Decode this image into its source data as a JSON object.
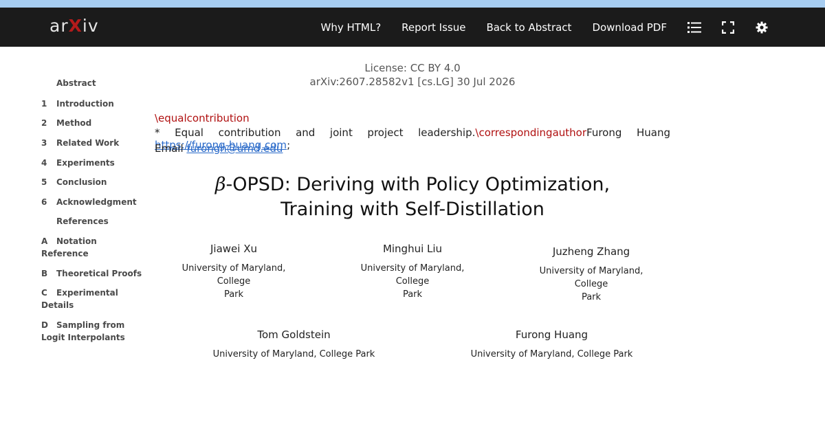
{
  "navbar": {
    "logo_pre": "ar",
    "logo_x": "X",
    "logo_post": "iv",
    "links": [
      "Why HTML?",
      "Report Issue",
      "Back to Abstract",
      "Download PDF"
    ],
    "icons": [
      "list-icon",
      "fullscreen-icon",
      "gear-icon"
    ]
  },
  "toc": [
    {
      "num": "",
      "text": "Abstract"
    },
    {
      "num": "1",
      "text": "Introduction"
    },
    {
      "num": "2",
      "text": "Method"
    },
    {
      "num": "3",
      "text": "Related Work"
    },
    {
      "num": "4",
      "text": "Experiments"
    },
    {
      "num": "5",
      "text": "Conclusion"
    },
    {
      "num": "6",
      "text": "Acknowledgment"
    },
    {
      "num": "",
      "text": "References"
    },
    {
      "num": "A",
      "text": "Notation",
      "text2": "Reference"
    },
    {
      "num": "B",
      "text": "Theoretical Proofs"
    },
    {
      "num": "C",
      "text": "Experimental",
      "text2": "Details"
    },
    {
      "num": "D",
      "text": "Sampling from",
      "text2": "Logit Interpolants"
    }
  ],
  "header": {
    "license": "License: CC BY 4.0",
    "arxiv_id": "arXiv:2607.28582v1 [cs.LG] 30 Jul 2026"
  },
  "notes": {
    "equal_contribution": "\\equalcontribution",
    "contrib_prefix": "* Equal contribution and joint project leadership.",
    "corresponding": "\\correspondingauthor",
    "contrib_name": "Furong Huang",
    "url": "https://furong-huang.com",
    "url_suffix": ";",
    "email_label": "Email",
    "email": "furongh@umd.edu"
  },
  "title": {
    "beta": "β",
    "line1": "-OPSD: Deriving with Policy Optimization,",
    "line2": "Training with Self-Distillation"
  },
  "authors": [
    {
      "name": "Jiawei Xu",
      "aff1": "University of Maryland, College",
      "aff2": "Park"
    },
    {
      "name": "Minghui Liu",
      "aff1": "University of Maryland, College",
      "aff2": "Park"
    },
    {
      "name": "Juzheng Zhang",
      "aff1": "University of Maryland, College",
      "aff2": "Park"
    },
    {
      "name": "Tom Goldstein",
      "aff1": "University of Maryland, College Park",
      "aff2": ""
    },
    {
      "name": "Furong Huang",
      "aff1": "University of Maryland, College Park",
      "aff2": ""
    }
  ]
}
